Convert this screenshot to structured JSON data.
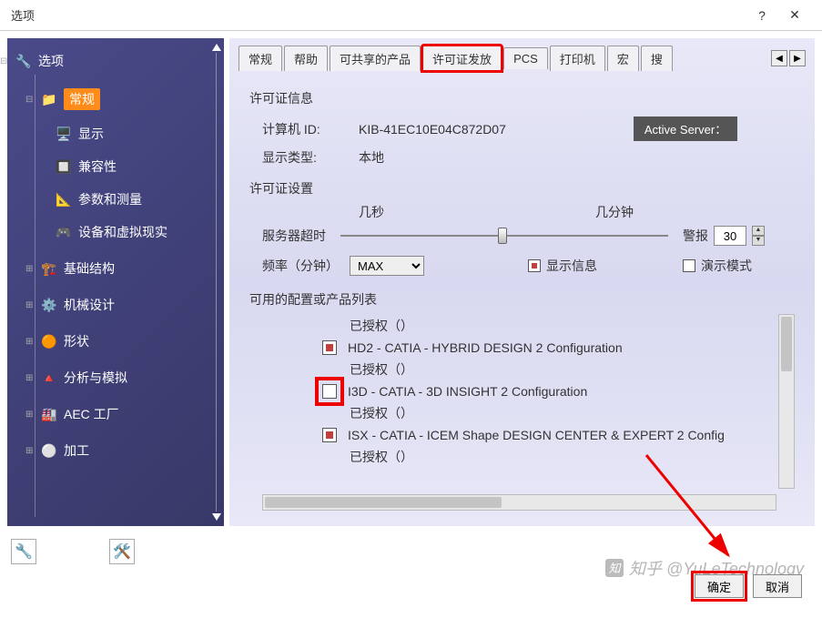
{
  "titlebar": {
    "title": "选项",
    "help": "?",
    "close": "✕"
  },
  "tree": {
    "root": "选项",
    "selected": "常规",
    "children": [
      "显示",
      "兼容性",
      "参数和测量",
      "设备和虚拟现实"
    ],
    "siblings": [
      "基础结构",
      "机械设计",
      "形状",
      "分析与模拟",
      "AEC 工厂",
      "加工"
    ]
  },
  "tabs": {
    "items": [
      "常规",
      "帮助",
      "可共享的产品",
      "许可证发放",
      "PCS",
      "打印机",
      "宏",
      "搜"
    ],
    "highlighted_index": 3
  },
  "license_info": {
    "section": "许可证信息",
    "computer_id_label": "计算机 ID:",
    "computer_id": "KIB-41EC10E04C872D07",
    "display_type_label": "显示类型:",
    "display_type": "本地",
    "active_server": "Active Server："
  },
  "license_settings": {
    "section": "许可证设置",
    "axis_seconds": "几秒",
    "axis_minutes": "几分钟",
    "server_timeout": "服务器超时",
    "alarm_label": "警报",
    "alarm_value": "30",
    "freq_label": "频率（分钟）",
    "freq_value": "MAX",
    "show_info": "显示信息",
    "demo_mode": "演示模式"
  },
  "config_list": {
    "section": "可用的配置或产品列表",
    "authorized": "已授权（）",
    "items": [
      "HD2 - CATIA - HYBRID DESIGN 2 Configuration",
      "I3D - CATIA - 3D INSIGHT 2 Configuration",
      "ISX - CATIA - ICEM Shape DESIGN CENTER & EXPERT 2 Config"
    ]
  },
  "buttons": {
    "ok": "确定",
    "cancel": "取消"
  },
  "watermark": "知乎 @YuLeTechnology"
}
